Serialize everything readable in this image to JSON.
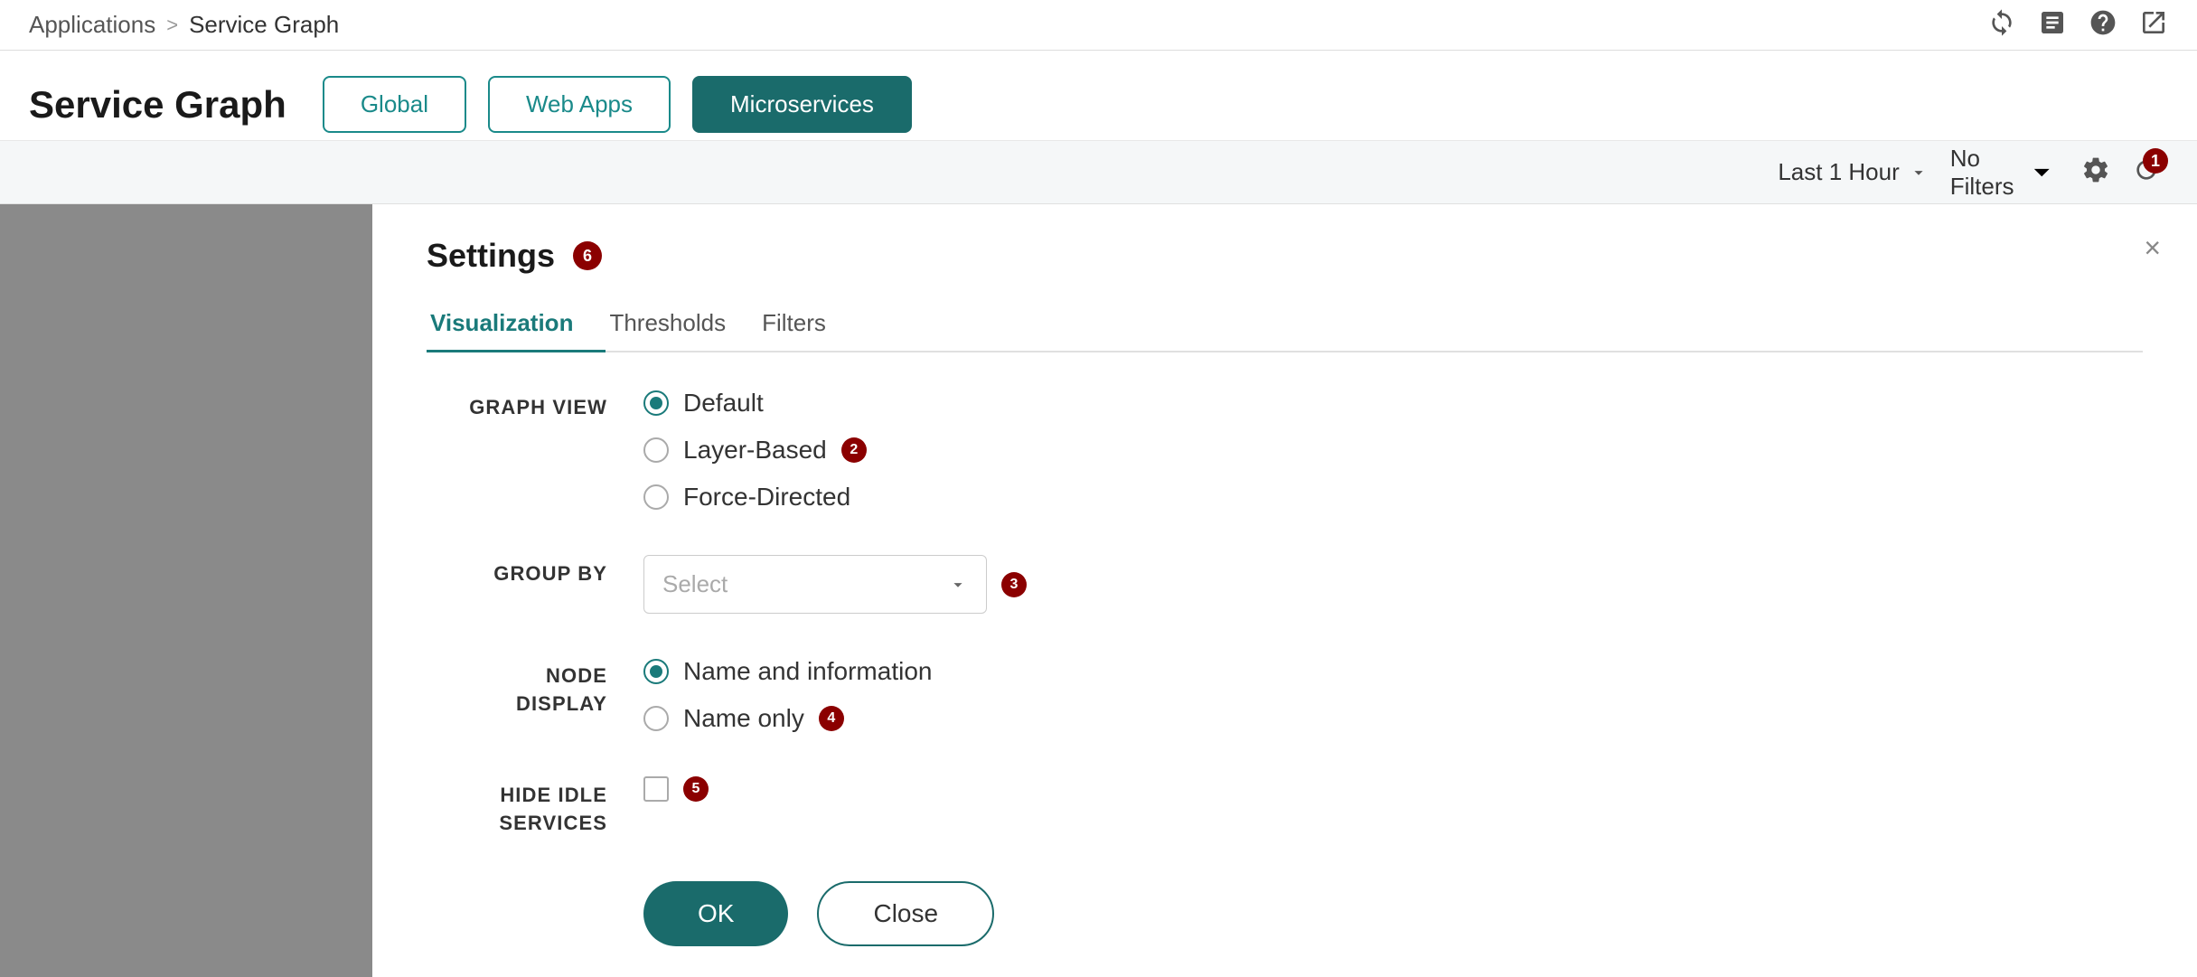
{
  "topbar": {
    "breadcrumb_app": "Applications",
    "breadcrumb_sep": ">",
    "breadcrumb_current": "Service Graph"
  },
  "header": {
    "title": "Service Graph",
    "tabs": [
      {
        "id": "global",
        "label": "Global",
        "active": false
      },
      {
        "id": "webapps",
        "label": "Web Apps",
        "active": false
      },
      {
        "id": "microservices",
        "label": "Microservices",
        "active": true
      }
    ]
  },
  "toolbar": {
    "time_filter": "Last 1 Hour",
    "filters_label": "No Filters",
    "notification_badge": "1"
  },
  "settings": {
    "title": "Settings",
    "badge": "6",
    "close_label": "×",
    "tabs": [
      {
        "id": "visualization",
        "label": "Visualization",
        "active": true
      },
      {
        "id": "thresholds",
        "label": "Thresholds",
        "active": false
      },
      {
        "id": "filters",
        "label": "Filters",
        "active": false
      }
    ],
    "graph_view": {
      "label": "GRAPH VIEW",
      "options": [
        {
          "id": "default",
          "label": "Default",
          "checked": true
        },
        {
          "id": "layer-based",
          "label": "Layer-Based",
          "checked": false,
          "badge": "2"
        },
        {
          "id": "force-directed",
          "label": "Force-Directed",
          "checked": false
        }
      ]
    },
    "group_by": {
      "label": "GROUP BY",
      "placeholder": "Select",
      "badge": "3"
    },
    "node_display": {
      "label": "NODE\nDISPLAY",
      "options": [
        {
          "id": "name-info",
          "label": "Name and information",
          "checked": true
        },
        {
          "id": "name-only",
          "label": "Name only",
          "checked": false,
          "badge": "4"
        }
      ]
    },
    "hide_idle": {
      "label": "HIDE IDLE\nSERVICES",
      "checked": false,
      "badge": "5"
    },
    "ok_button": "OK",
    "close_button": "Close"
  }
}
